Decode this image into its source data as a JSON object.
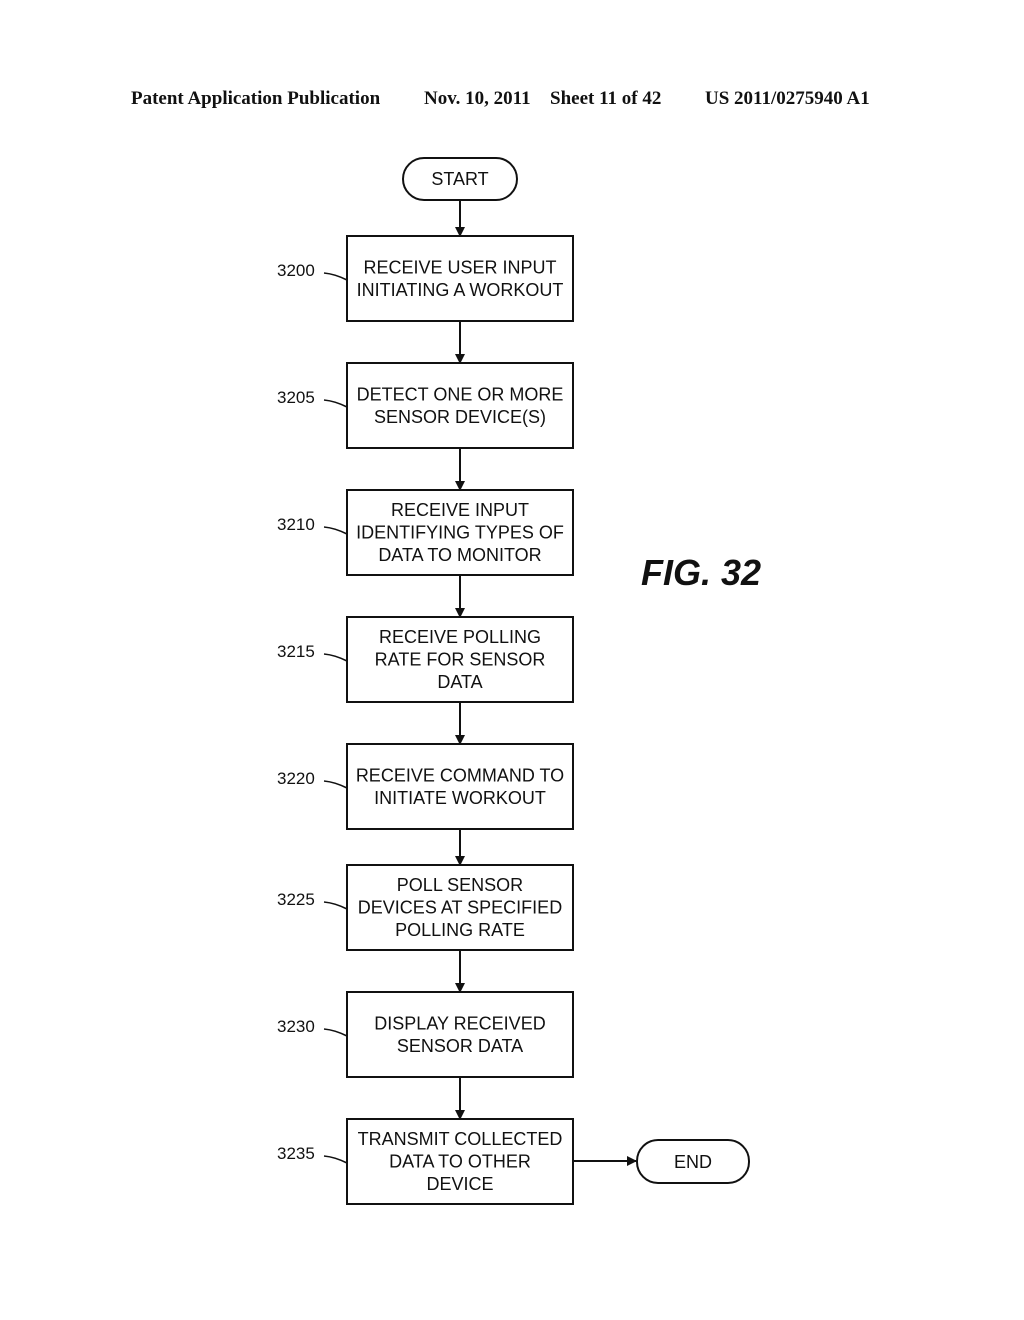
{
  "header": {
    "publication": "Patent Application Publication",
    "date": "Nov. 10, 2011",
    "sheet": "Sheet 11 of 42",
    "number": "US 2011/0275940 A1"
  },
  "figure_label": "FIG. 32",
  "flowchart": {
    "start": "START",
    "end": "END",
    "steps": [
      {
        "ref": "3200",
        "lines": [
          "RECEIVE USER INPUT",
          "INITIATING A WORKOUT"
        ]
      },
      {
        "ref": "3205",
        "lines": [
          "DETECT ONE OR MORE",
          "SENSOR DEVICE(S)"
        ]
      },
      {
        "ref": "3210",
        "lines": [
          "RECEIVE INPUT",
          "IDENTIFYING TYPES OF",
          "DATA TO MONITOR"
        ]
      },
      {
        "ref": "3215",
        "lines": [
          "RECEIVE POLLING",
          "RATE FOR SENSOR",
          "DATA"
        ]
      },
      {
        "ref": "3220",
        "lines": [
          "RECEIVE COMMAND TO",
          "INITIATE WORKOUT"
        ]
      },
      {
        "ref": "3225",
        "lines": [
          "POLL SENSOR",
          "DEVICES AT SPECIFIED",
          "POLLING RATE"
        ]
      },
      {
        "ref": "3230",
        "lines": [
          "DISPLAY RECEIVED",
          "SENSOR DATA"
        ]
      },
      {
        "ref": "3235",
        "lines": [
          "TRANSMIT COLLECTED",
          "DATA TO OTHER",
          "DEVICE"
        ]
      }
    ]
  }
}
